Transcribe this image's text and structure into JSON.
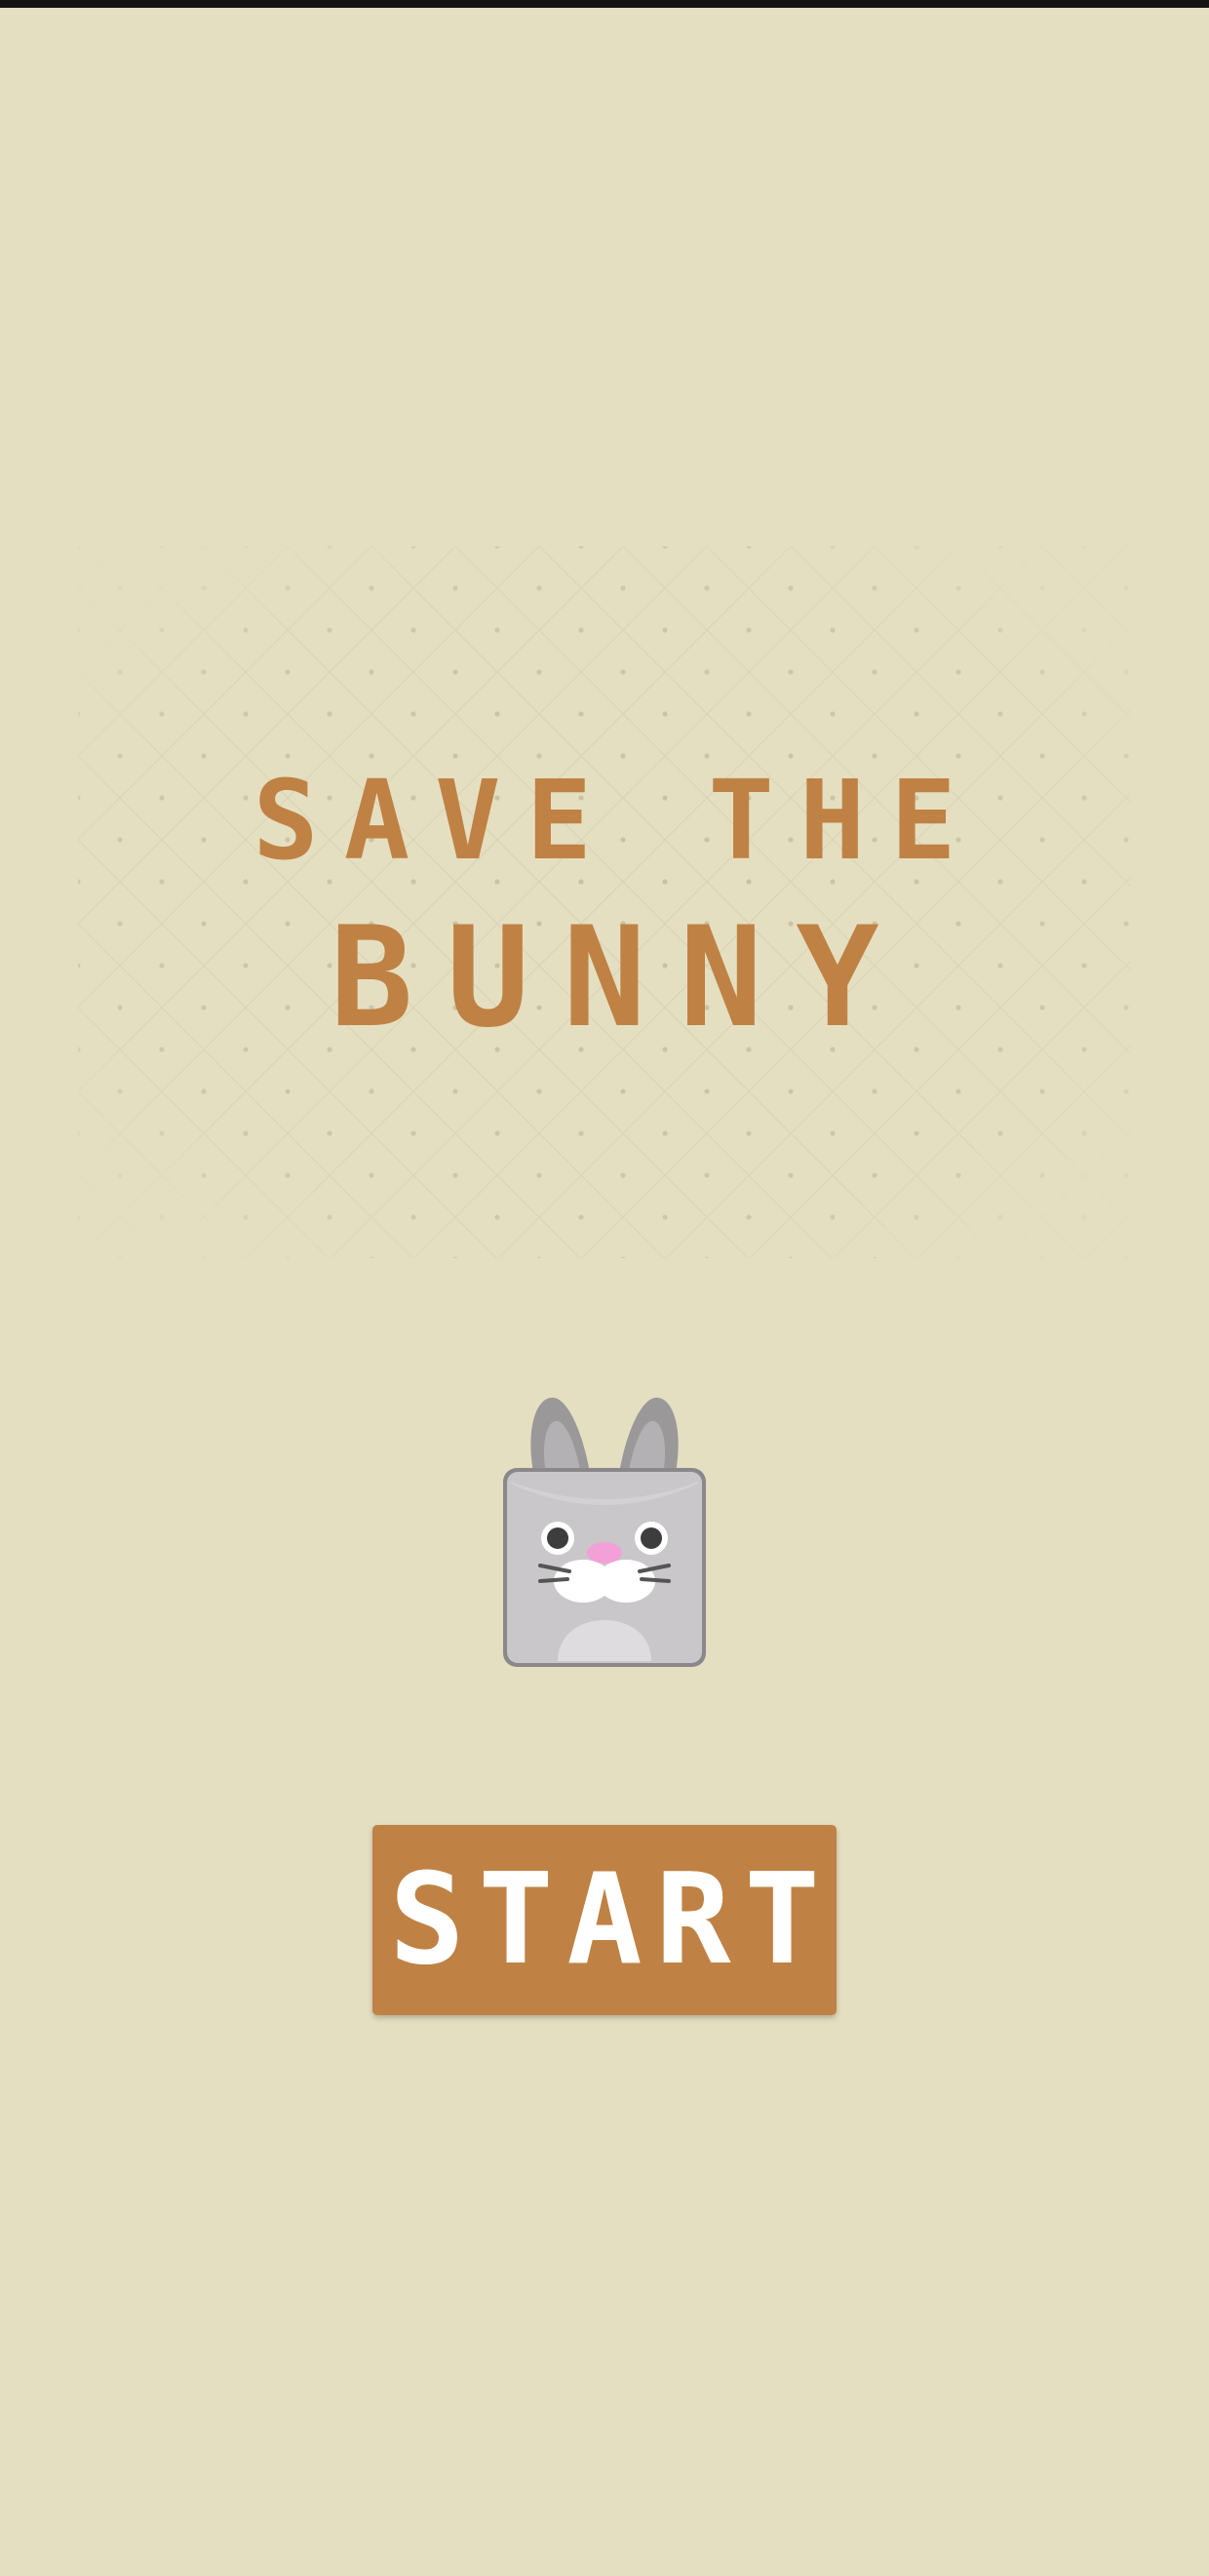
{
  "screen": "title-screen",
  "title": {
    "line1": "SAVE THE",
    "line2": "BUNNY"
  },
  "character": {
    "name": "bunny-icon"
  },
  "start_button": {
    "label": "START"
  },
  "colors": {
    "background": "#e5dfc2",
    "accent": "#bf8244",
    "button_text": "#ffffff",
    "bunny_body": "#c9c7c9",
    "bunny_nose": "#f4a0d8"
  }
}
